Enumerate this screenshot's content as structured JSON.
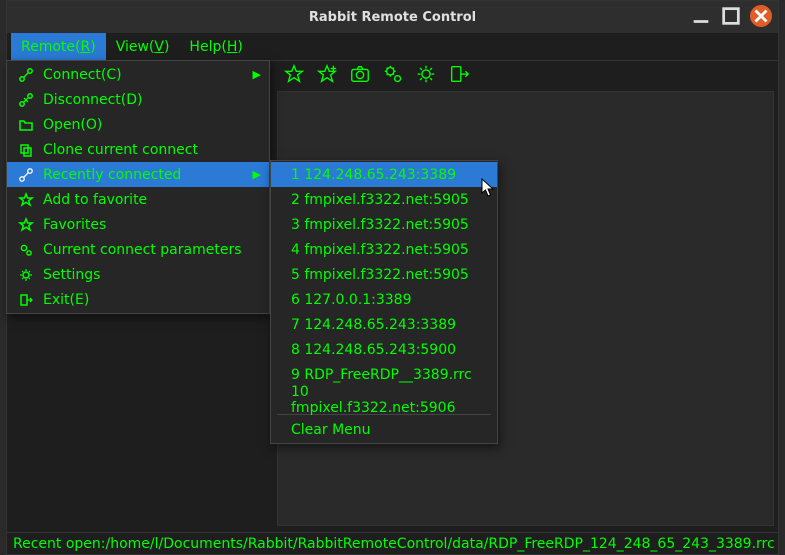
{
  "window": {
    "title": "Rabbit Remote Control"
  },
  "menubar": {
    "remote": "Remote(",
    "remote_ul": "R",
    "remote_after": ")",
    "view": "View(",
    "view_ul": "V",
    "view_after": ")",
    "help": "Help(",
    "help_ul": "H",
    "help_after": ")"
  },
  "remote_menu": {
    "connect": "Connect(",
    "connect_ul": "C",
    "connect_after": ")",
    "disconnect": "Disconnect(",
    "disconnect_ul": "D",
    "disconnect_after": ")",
    "open": "Open(",
    "open_ul": "O",
    "open_after": ")",
    "clone": "Clone current connect",
    "recent": "Recently connected",
    "add_fav": "Add to favorite",
    "favorites": "Favorites",
    "params": "Current connect parameters",
    "settings": "Settings",
    "exit": "Exit(",
    "exit_ul": "E",
    "exit_after": ")"
  },
  "recent_list": [
    "1 124.248.65.243:3389",
    "2 fmpixel.f3322.net:5905",
    "3 fmpixel.f3322.net:5905",
    "4 fmpixel.f3322.net:5905",
    "5 fmpixel.f3322.net:5905",
    "6 127.0.0.1:3389",
    "7 124.248.65.243:3389",
    "8 124.248.65.243:5900",
    "9 RDP_FreeRDP__3389.rrc",
    "10 fmpixel.f3322.net:5906"
  ],
  "recent_clear": "Clear Menu",
  "statusbar": "Recent open:/home/l/Documents/Rabbit/RabbitRemoteControl/data/RDP_FreeRDP_124_248_65_243_3389.rrc"
}
